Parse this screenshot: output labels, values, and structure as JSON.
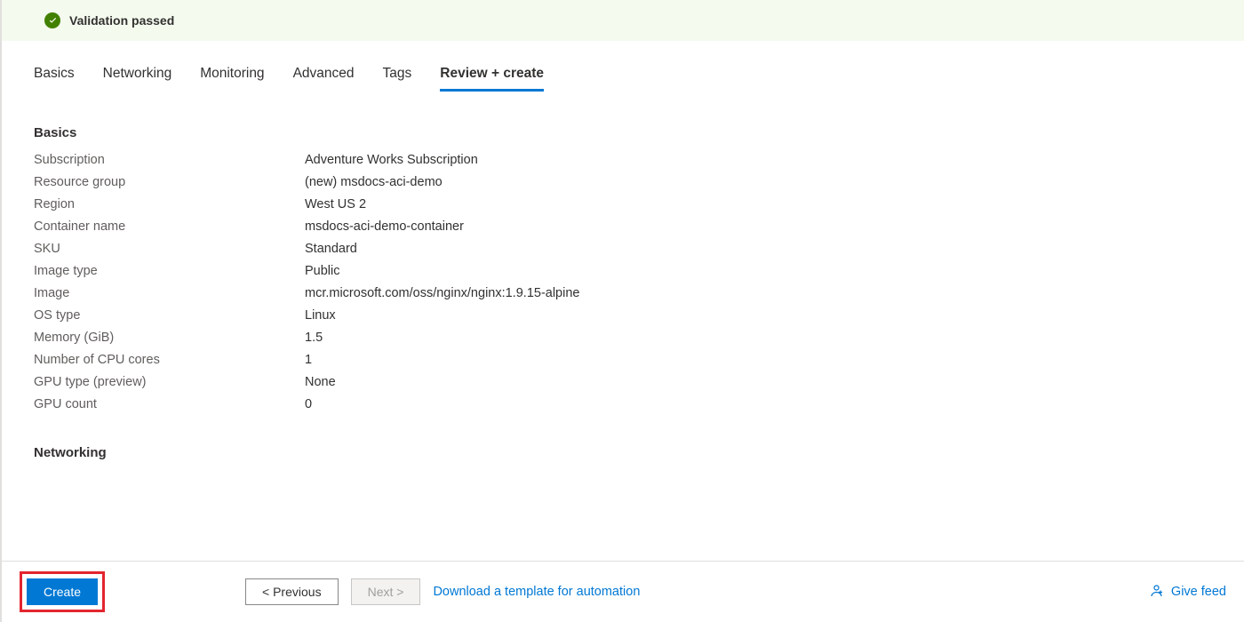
{
  "validation": {
    "message": "Validation passed"
  },
  "tabs": [
    {
      "label": "Basics"
    },
    {
      "label": "Networking"
    },
    {
      "label": "Monitoring"
    },
    {
      "label": "Advanced"
    },
    {
      "label": "Tags"
    },
    {
      "label": "Review + create"
    }
  ],
  "sections": {
    "basics": {
      "heading": "Basics",
      "rows": [
        {
          "label": "Subscription",
          "value": "Adventure Works Subscription"
        },
        {
          "label": "Resource group",
          "value": "(new) msdocs-aci-demo"
        },
        {
          "label": "Region",
          "value": "West US 2"
        },
        {
          "label": "Container name",
          "value": "msdocs-aci-demo-container"
        },
        {
          "label": "SKU",
          "value": "Standard"
        },
        {
          "label": "Image type",
          "value": "Public"
        },
        {
          "label": "Image",
          "value": "mcr.microsoft.com/oss/nginx/nginx:1.9.15-alpine"
        },
        {
          "label": "OS type",
          "value": "Linux"
        },
        {
          "label": "Memory (GiB)",
          "value": "1.5"
        },
        {
          "label": "Number of CPU cores",
          "value": "1"
        },
        {
          "label": "GPU type (preview)",
          "value": "None"
        },
        {
          "label": "GPU count",
          "value": "0"
        }
      ]
    },
    "networking": {
      "heading": "Networking"
    }
  },
  "footer": {
    "create": "Create",
    "previous": "<  Previous",
    "next": "Next  >",
    "download_template": "Download a template for automation",
    "feedback": "Give feed"
  }
}
